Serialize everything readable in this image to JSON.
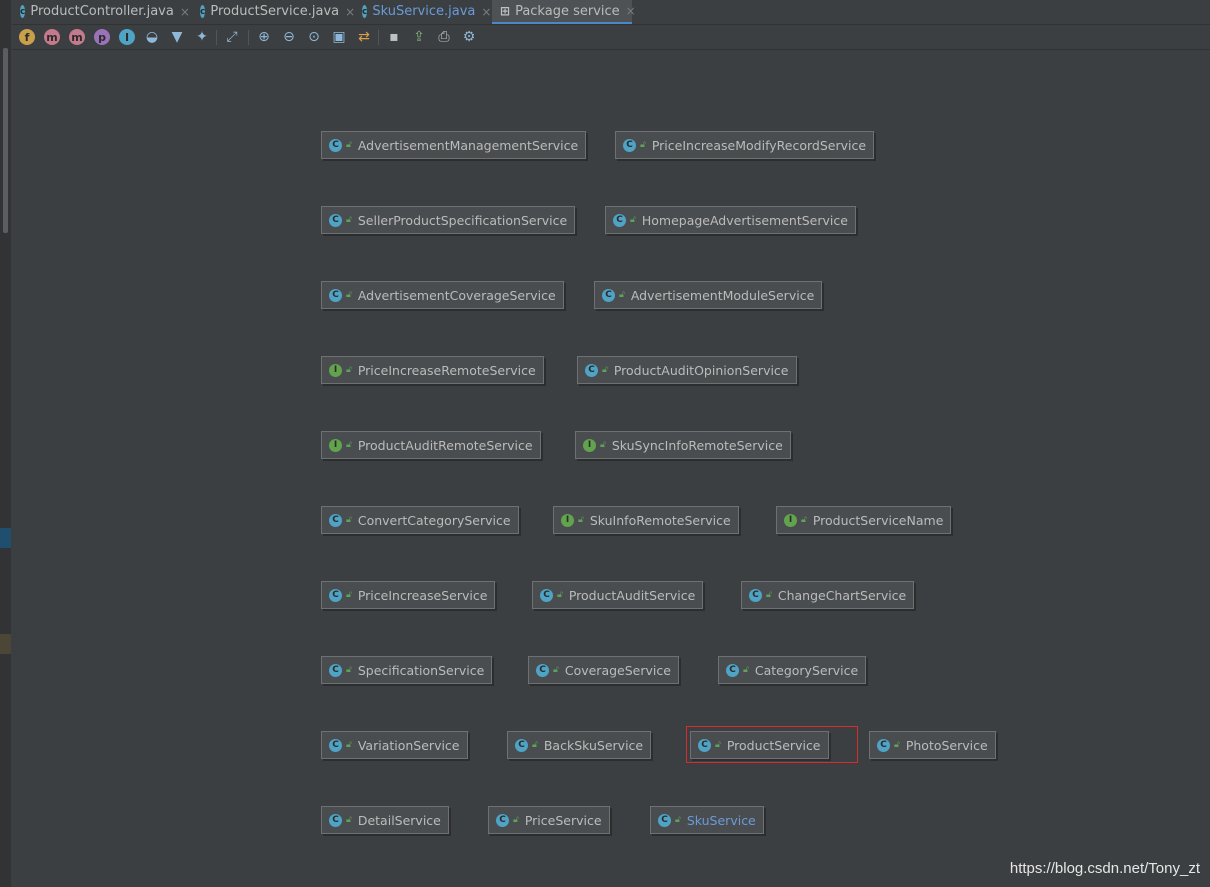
{
  "tabs": [
    {
      "label": "ProductController.java",
      "icon": "class-icon",
      "active": false
    },
    {
      "label": "ProductService.java",
      "icon": "class-icon",
      "active": false
    },
    {
      "label": "SkuService.java",
      "icon": "class-icon",
      "active": false
    },
    {
      "label": "Package service",
      "icon": "package-diagram-icon",
      "active": true
    }
  ],
  "toolbar": {
    "icons": [
      "fields-filter-icon",
      "constructors-filter-icon",
      "methods-filter-icon",
      "properties-filter-icon",
      "inner-classes-filter-icon",
      "visibility-filter-icon",
      "filter-icon",
      "pin-icon",
      "layout-icon",
      "zoom-in-icon",
      "zoom-out-icon",
      "actual-size-icon",
      "fit-content-icon",
      "apply-layout-icon",
      "save-icon",
      "export-icon",
      "print-icon",
      "settings-icon"
    ],
    "letters": {
      "fields": "f",
      "constructors": "m",
      "methods": "m",
      "properties": "p",
      "inner": "I"
    }
  },
  "diagram": {
    "nodes": [
      {
        "name": "AdvertisementManagementService",
        "kind": "C"
      },
      {
        "name": "PriceIncreaseModifyRecordService",
        "kind": "C"
      },
      {
        "name": "SellerProductSpecificationService",
        "kind": "C"
      },
      {
        "name": "HomepageAdvertisementService",
        "kind": "C"
      },
      {
        "name": "AdvertisementCoverageService",
        "kind": "C"
      },
      {
        "name": "AdvertisementModuleService",
        "kind": "C"
      },
      {
        "name": "PriceIncreaseRemoteService",
        "kind": "I"
      },
      {
        "name": "ProductAuditOpinionService",
        "kind": "C"
      },
      {
        "name": "ProductAuditRemoteService",
        "kind": "I"
      },
      {
        "name": "SkuSyncInfoRemoteService",
        "kind": "I"
      },
      {
        "name": "ConvertCategoryService",
        "kind": "C"
      },
      {
        "name": "SkuInfoRemoteService",
        "kind": "I"
      },
      {
        "name": "ProductServiceName",
        "kind": "I"
      },
      {
        "name": "PriceIncreaseService",
        "kind": "C"
      },
      {
        "name": "ProductAuditService",
        "kind": "C"
      },
      {
        "name": "ChangeChartService",
        "kind": "C"
      },
      {
        "name": "SpecificationService",
        "kind": "C"
      },
      {
        "name": "CoverageService",
        "kind": "C"
      },
      {
        "name": "CategoryService",
        "kind": "C"
      },
      {
        "name": "VariationService",
        "kind": "C"
      },
      {
        "name": "BackSkuService",
        "kind": "C"
      },
      {
        "name": "ProductService",
        "kind": "C",
        "selected": true
      },
      {
        "name": "PhotoService",
        "kind": "C"
      },
      {
        "name": "DetailService",
        "kind": "C"
      },
      {
        "name": "PriceService",
        "kind": "C"
      },
      {
        "name": "SkuService",
        "kind": "C",
        "highlighted": true
      }
    ]
  },
  "watermark": "https://blog.csdn.net/Tony_zt",
  "colors": {
    "background": "#3c3f41",
    "class_icon": "#4fa3c5",
    "interface_icon": "#62a34d",
    "selection": "#d62c2c",
    "active_tab_underline": "#4a88c7"
  }
}
